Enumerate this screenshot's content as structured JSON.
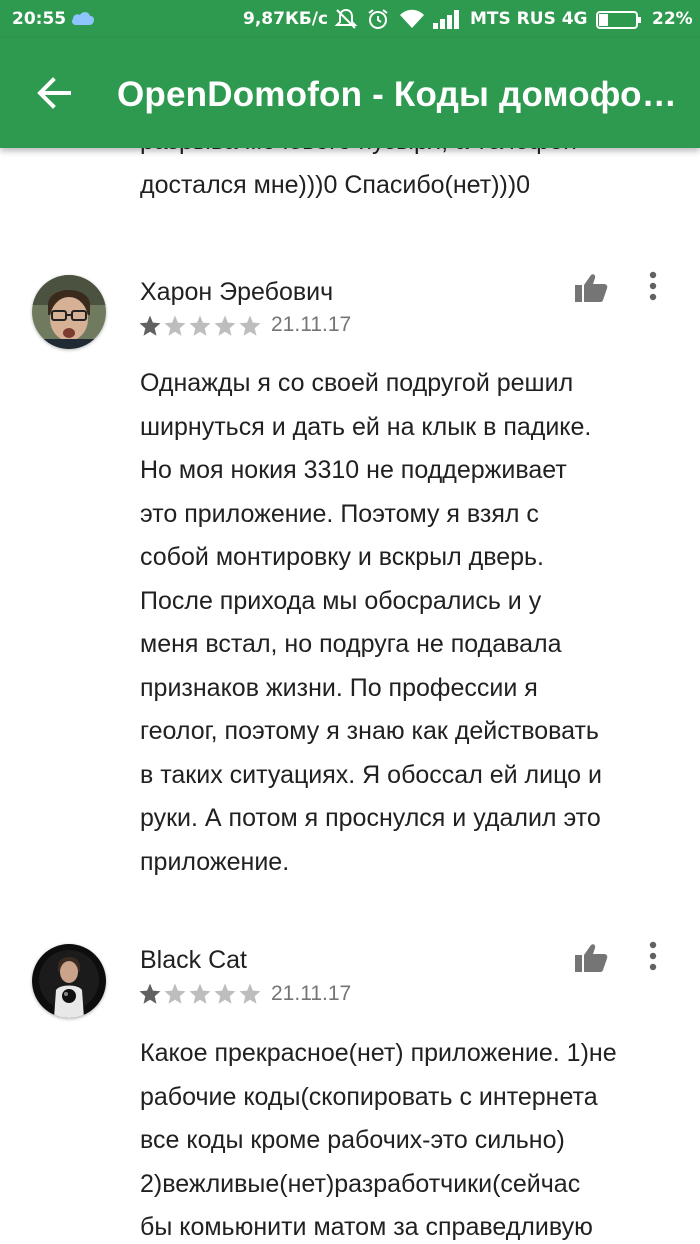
{
  "status_bar": {
    "time": "20:55",
    "speed": "9,87КБ/с",
    "carrier": "MTS RUS 4G",
    "battery": "22%",
    "icons": [
      "cloud-icon",
      "mute-icon",
      "alarm-icon",
      "wifi-icon",
      "signal-icon",
      "battery-icon"
    ]
  },
  "app_bar": {
    "title": "OpenDomofon - Коды домофо…",
    "back_icon": "arrow-back-icon",
    "color": "#2e9a4f"
  },
  "previous_review": {
    "text_lines": [
      "разрыва мочевого пузыря, а телефон",
      "достался мне)))0 Спасибо(нет)))0"
    ]
  },
  "reviews": [
    {
      "author": "Харон Эребович",
      "rating": 1,
      "max_rating": 5,
      "date": "21.11.17",
      "text_lines": [
        "Однажды я со своей подругой решил",
        "ширнуться и дать ей на клык в падике.",
        "Но моя нокия 3310 не поддерживает",
        "это приложение. Поэтому я взял с",
        "собой монтировку и вскрыл дверь.",
        "После прихода мы обосрались и у",
        "меня встал, но подруга не подавала",
        "признаков жизни. По профессии я",
        "геолог, поэтому я знаю как действовать",
        "в таких ситуациях. Я обоссал ей лицо и",
        "руки. А потом я проснулся и удалил это",
        "приложение."
      ]
    },
    {
      "author": "Black Cat",
      "rating": 1,
      "max_rating": 5,
      "date": "21.11.17",
      "text_lines": [
        "Какое прекрасное(нет) приложение. 1)не",
        "рабочие коды(скопировать с интернета",
        "все коды кроме рабочих-это сильно)",
        "2)вежливые(нет)разработчики(сейчас",
        "бы комьюнити матом за справедливую"
      ]
    }
  ],
  "colors": {
    "star_filled": "#616161",
    "star_empty": "#bdbdbd",
    "icon_gray": "#757575"
  }
}
